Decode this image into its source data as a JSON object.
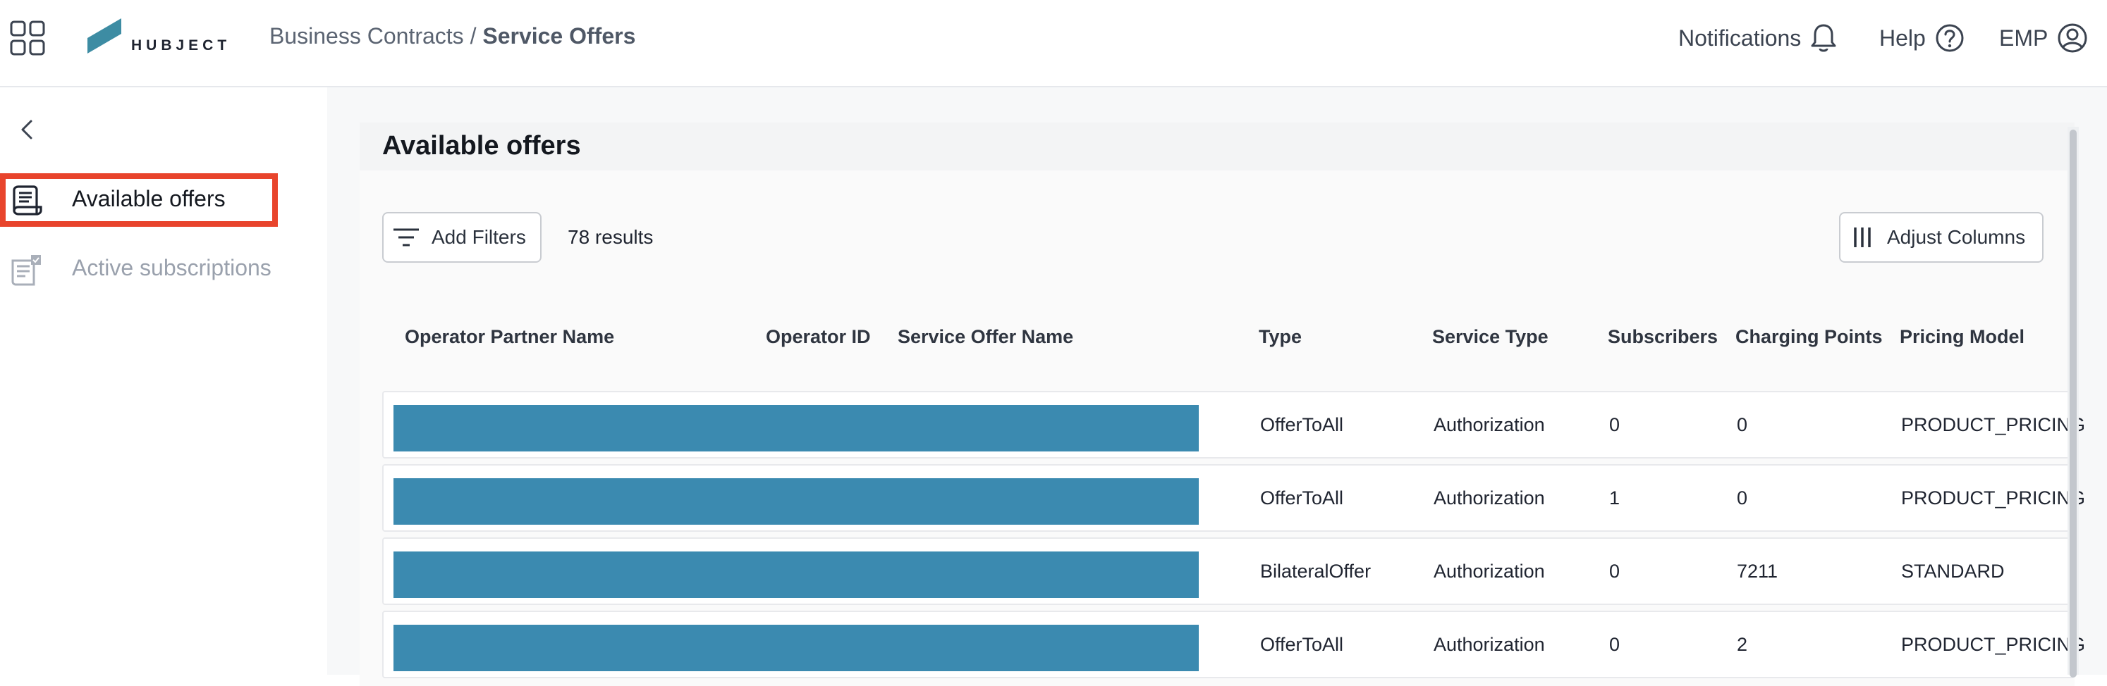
{
  "header": {
    "logo_text": "HUBJECT",
    "breadcrumb_parent": "Business Contracts",
    "breadcrumb_separator": "/",
    "breadcrumb_current": "Service Offers",
    "notifications_label": "Notifications",
    "help_label": "Help",
    "user_label": "EMP"
  },
  "sidebar": {
    "items": [
      {
        "label": "Available offers",
        "icon": "receipt-icon",
        "active": true
      },
      {
        "label": "Active subscriptions",
        "icon": "checklist-icon",
        "active": false
      }
    ]
  },
  "main": {
    "title": "Available offers",
    "add_filters_label": "Add Filters",
    "results_text": "78 results",
    "adjust_columns_label": "Adjust Columns",
    "columns": [
      "Operator Partner Name",
      "Operator ID",
      "Service Offer Name",
      "Type",
      "Service Type",
      "Subscribers",
      "Charging Points",
      "Pricing Model"
    ],
    "rows": [
      {
        "type": "OfferToAll",
        "service_type": "Authorization",
        "subscribers": "0",
        "charging_points": "0",
        "pricing_model": "PRODUCT_PRICING"
      },
      {
        "type": "OfferToAll",
        "service_type": "Authorization",
        "subscribers": "1",
        "charging_points": "0",
        "pricing_model": "PRODUCT_PRICING"
      },
      {
        "type": "BilateralOffer",
        "service_type": "Authorization",
        "subscribers": "0",
        "charging_points": "7211",
        "pricing_model": "STANDARD"
      },
      {
        "type": "OfferToAll",
        "service_type": "Authorization",
        "subscribers": "0",
        "charging_points": "2",
        "pricing_model": "PRODUCT_PRICING"
      }
    ]
  },
  "colors": {
    "accent": "#3b8ab0",
    "highlight": "#e8442c"
  }
}
